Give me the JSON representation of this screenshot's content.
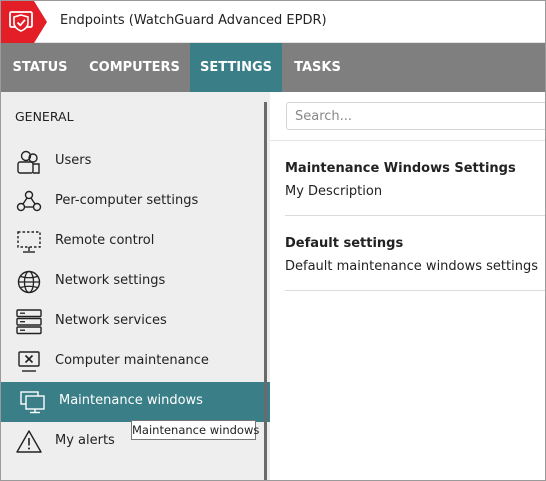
{
  "header": {
    "title": "Endpoints  (WatchGuard Advanced EPDR)",
    "logo_icon": "shield-check-icon",
    "brand_color": "#e41e26"
  },
  "nav": {
    "tabs": [
      {
        "label": "STATUS"
      },
      {
        "label": "COMPUTERS"
      },
      {
        "label": "SETTINGS",
        "active": true
      },
      {
        "label": "TASKS"
      }
    ],
    "bg_color": "#7f7f7f",
    "active_color": "#3a7f88"
  },
  "sidebar": {
    "section_title": "GENERAL",
    "items": [
      {
        "label": "Users",
        "icon": "users-icon"
      },
      {
        "label": "Per-computer settings",
        "icon": "network-nodes-icon"
      },
      {
        "label": "Remote control",
        "icon": "remote-control-icon"
      },
      {
        "label": "Network settings",
        "icon": "globe-icon"
      },
      {
        "label": "Network services",
        "icon": "server-icon"
      },
      {
        "label": "Computer maintenance",
        "icon": "computer-maintenance-icon"
      },
      {
        "label": "Maintenance windows",
        "icon": "monitors-icon",
        "active": true
      },
      {
        "label": "My alerts",
        "icon": "warning-icon"
      }
    ],
    "tooltip": "Maintenance windows"
  },
  "main": {
    "search_placeholder": "Search...",
    "settings": [
      {
        "title": "Maintenance Windows Settings",
        "description": "My Description"
      },
      {
        "title": "Default settings",
        "description": "Default maintenance windows settings"
      }
    ]
  }
}
